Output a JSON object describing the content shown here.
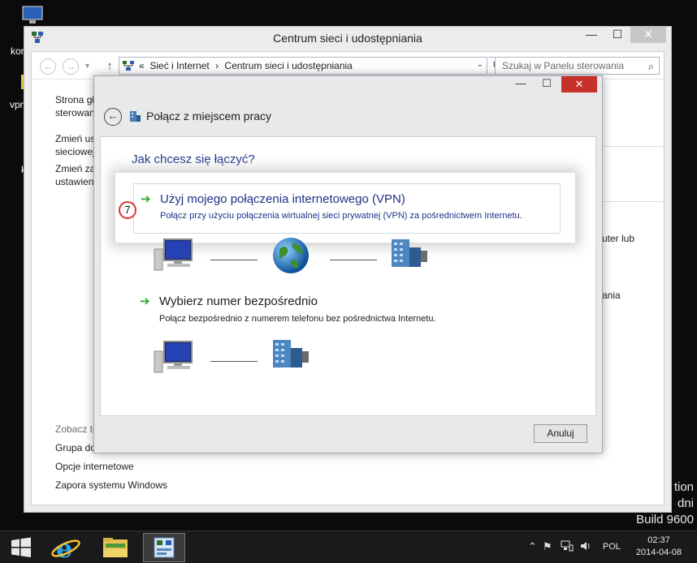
{
  "desktop": {
    "labels": [
      "kor",
      "vpn",
      "k"
    ],
    "watermark": {
      "line1": "tion",
      "line2": "dni",
      "line3": "Build 9600"
    }
  },
  "main_window": {
    "title": "Centrum sieci i udostępniania",
    "controls": {
      "minimize": "—",
      "maximize": "☐",
      "close": "✕"
    },
    "nav": {
      "back": "←",
      "forward": "→",
      "up": "↑",
      "breadcrumb_prefix": "«",
      "breadcrumb": [
        "Sieć i Internet",
        "Centrum sieci i udostępniania"
      ],
      "breadcrumb_sep": "›",
      "dropdown": "⌄",
      "refresh": "↻",
      "search_placeholder": "Szukaj w Panelu sterowania",
      "search_icon": "⌕"
    },
    "sidebar": {
      "links": [
        {
          "line1": "Strona gł",
          "line2": "sterowani"
        },
        {
          "line1": "Zmień us",
          "line2": "sieciowej"
        },
        {
          "line1": "Zmień za",
          "line2": "ustawieni"
        }
      ],
      "see_also": "Zobacz te",
      "see_also_links": [
        "Grupa do",
        "Opcje internetowe",
        "Zapora systemu Windows"
      ]
    },
    "right_fragments": {
      "router": "uter lub",
      "sharing": "ania"
    }
  },
  "dialog": {
    "title": "Połącz z miejscem pracy",
    "controls": {
      "minimize": "—",
      "maximize": "☐",
      "close": "✕",
      "back": "←"
    },
    "question": "Jak chcesz się łączyć?",
    "step_badge": "7",
    "options": [
      {
        "arrow": "➔",
        "title": "Użyj mojego połączenia internetowego (VPN)",
        "desc": "Połącz przy użyciu połączenia wirtualnej sieci prywatnej (VPN) za pośrednictwem Internetu.",
        "highlighted": true
      },
      {
        "arrow": "➔",
        "title": "Wybierz numer bezpośrednio",
        "desc": "Połącz bezpośrednio z numerem telefonu bez pośrednictwa Internetu.",
        "highlighted": false
      }
    ],
    "cancel": "Anuluj"
  },
  "taskbar": {
    "language": "POL",
    "time": "02:37",
    "date": "2014-04-08"
  },
  "colors": {
    "link_blue": "#1e3287",
    "arrow_green": "#2aa52a",
    "close_red": "#c7312b",
    "badge_red": "#dd3333"
  }
}
